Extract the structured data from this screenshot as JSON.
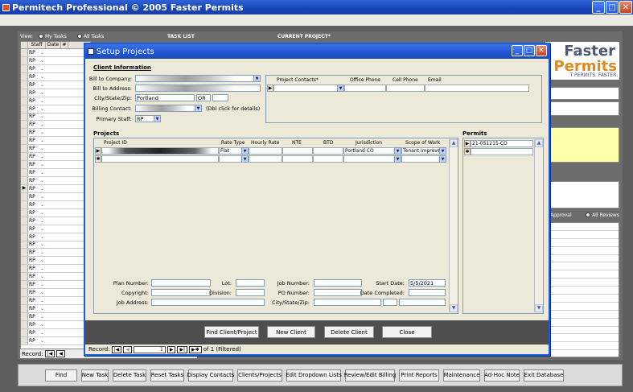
{
  "window": {
    "title": "Permitech Professional  © 2005 Faster Permits",
    "min": "_",
    "max": "□",
    "close": "✕"
  },
  "main": {
    "view_label": "View:",
    "my_tasks": "My Tasks",
    "all_tasks": "All Tasks",
    "task_list": "TASK LIST",
    "current_project": "CURRENT PROJECT*",
    "columns": [
      "Staff",
      "Date",
      "#"
    ],
    "staff_value": "RP",
    "record_label": "Record:",
    "logo_word1": "Faster",
    "logo_word2": "Permits",
    "logo_tag": "T PERMITS. FASTER.",
    "approval_label": "Approval",
    "all_reviews_label": "All Reviews"
  },
  "bottom_buttons": [
    "Find",
    "New Task",
    "Delete Task",
    "Reset Tasks",
    "Display Contacts",
    "Clients/Projects",
    "Edit Dropdown Lists",
    "Review/Edit Billing",
    "Print Reports",
    "Maintenance",
    "Ad-Hoc Note",
    "Exit Database"
  ],
  "dialog": {
    "title": "Setup Projects",
    "client_info": "Client Information",
    "bill_to_company": "Bill to Company:",
    "bill_to_address": "Bill to Address:",
    "city_state_zip": "City/State/Zip:",
    "city": "Portland",
    "state": "OR",
    "billing_contact": "Billing Contact:",
    "dbl_click": "(Dbl click for details)",
    "primary_staff": "Primary Staff:",
    "primary_staff_value": "RP",
    "contact_headers": [
      "Project Contacts*",
      "Office Phone",
      "Cell Phone",
      "Email"
    ],
    "projects_title": "Projects",
    "project_headers": [
      "Project ID",
      "Rate Type",
      "Hourly Rate",
      "NTE",
      "BTD",
      "Jurisdiction",
      "Scope of Work"
    ],
    "project_row": {
      "rate_type": "Flat",
      "jurisdiction": "Portland CO",
      "scope": "Tenant Improve"
    },
    "permits_title": "Permits",
    "permit_value": "21-051215-CO",
    "plan_number": "Plan Number:",
    "lot": "Lot:",
    "job_number": "Job Number:",
    "start_date_label": "Start Date:",
    "start_date": "5/5/2021",
    "copyright": "Copyright:",
    "division": "Division:",
    "po_number": "PO Number:",
    "date_completed": "Date Completed:",
    "job_address": "Job Address:",
    "job_city_state_zip": "City/State/Zip:",
    "buttons": [
      "Find Client/Project",
      "New Client",
      "Delete Client",
      "Close"
    ],
    "record_label": "Record:",
    "record_value": "1",
    "record_of": "of 1 (Filtered)"
  }
}
